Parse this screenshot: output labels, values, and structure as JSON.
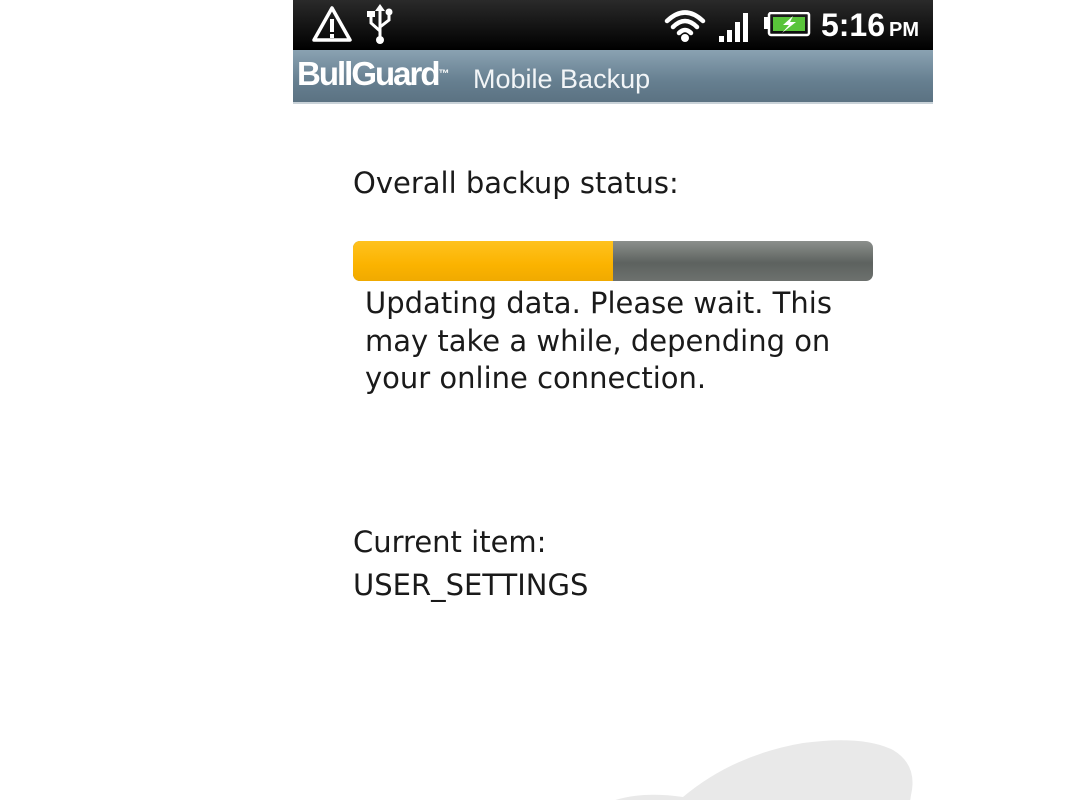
{
  "status_bar": {
    "time": "5:16",
    "ampm": "PM",
    "icons": [
      "alert-icon",
      "usb-icon",
      "wifi-icon",
      "signal-icon",
      "battery-charging-icon"
    ]
  },
  "app_bar": {
    "brand": "BullGuard",
    "trademark": "™",
    "product": "Mobile Backup"
  },
  "main": {
    "overall_label": "Overall backup status:",
    "progress_fraction": 0.5,
    "progress_color": "#fbb300",
    "track_color": "#5d625f",
    "message": "Updating data. Please wait. This may take a while, depending on your online connection.",
    "current_item_label": "Current item:",
    "current_item_value": "USER_SETTINGS"
  }
}
